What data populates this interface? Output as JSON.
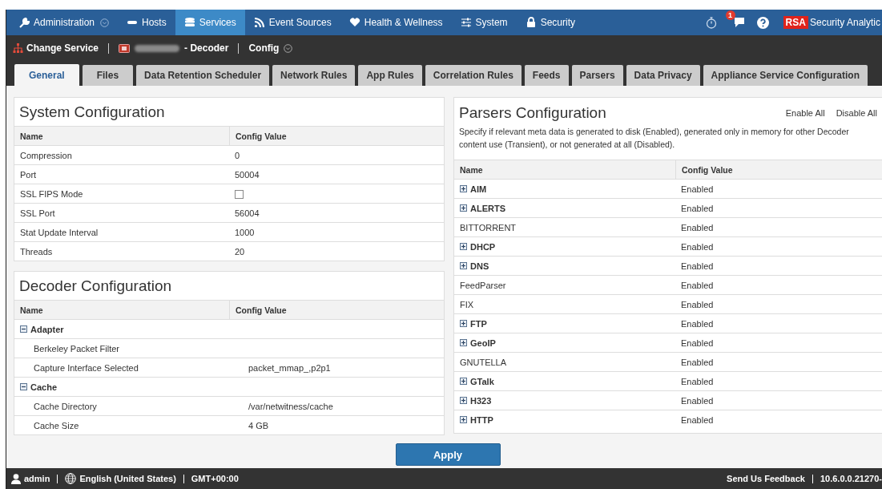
{
  "nav": {
    "items": [
      {
        "label": "Administration",
        "dropdown": true,
        "selected": false
      },
      {
        "label": "Hosts",
        "dropdown": false,
        "selected": false
      },
      {
        "label": "Services",
        "dropdown": false,
        "selected": true
      },
      {
        "label": "Event Sources",
        "dropdown": false,
        "selected": false
      },
      {
        "label": "Health & Wellness",
        "dropdown": false,
        "selected": false
      },
      {
        "label": "System",
        "dropdown": false,
        "selected": false
      },
      {
        "label": "Security",
        "dropdown": false,
        "selected": false
      }
    ],
    "notification_count": "1",
    "brand": "RSA",
    "product": "Security Analytic"
  },
  "service_bar": {
    "change_service": "Change Service",
    "service": "- Decoder",
    "view": "Config"
  },
  "tabs": [
    {
      "label": "General",
      "selected": true
    },
    {
      "label": "Files",
      "selected": false
    },
    {
      "label": "Data Retention Scheduler",
      "selected": false
    },
    {
      "label": "Network Rules",
      "selected": false
    },
    {
      "label": "App Rules",
      "selected": false
    },
    {
      "label": "Correlation Rules",
      "selected": false
    },
    {
      "label": "Feeds",
      "selected": false
    },
    {
      "label": "Parsers",
      "selected": false
    },
    {
      "label": "Data Privacy",
      "selected": false
    },
    {
      "label": "Appliance Service Configuration",
      "selected": false
    }
  ],
  "system_configuration": {
    "title": "System Configuration",
    "columns": [
      "Name",
      "Config Value"
    ],
    "rows": [
      {
        "kind": "text",
        "name": "Compression",
        "value": "0"
      },
      {
        "kind": "text",
        "name": "Port",
        "value": "50004"
      },
      {
        "kind": "checkbox",
        "name": "SSL FIPS Mode",
        "checked": false
      },
      {
        "kind": "text",
        "name": "SSL Port",
        "value": "56004"
      },
      {
        "kind": "text",
        "name": "Stat Update Interval",
        "value": "1000"
      },
      {
        "kind": "text",
        "name": "Threads",
        "value": "20"
      }
    ]
  },
  "decoder_configuration": {
    "title": "Decoder Configuration",
    "columns": [
      "Name",
      "Config Value"
    ],
    "groups": [
      {
        "name": "Adapter",
        "expanded": true,
        "children": [
          {
            "name": "Berkeley Packet Filter"
          },
          {
            "name": "Capture Interface Selected",
            "value": "packet_mmap_,p2p1"
          }
        ]
      },
      {
        "name": "Cache",
        "expanded": true,
        "children": [
          {
            "name": "Cache Directory",
            "value": "/var/netwitness/cache"
          },
          {
            "name": "Cache Size",
            "value": "4 GB"
          }
        ]
      }
    ]
  },
  "parsers_configuration": {
    "title": "Parsers Configuration",
    "actions": [
      "Enable All",
      "Disable All"
    ],
    "description": "Specify if relevant meta data is generated to disk (Enabled), generated only in memory for other Decoder content use (Transient), or not generated at all (Disabled).",
    "columns": [
      "Name",
      "Config Value"
    ],
    "rows": [
      {
        "kind": "group",
        "name": "AIM",
        "value": "Enabled",
        "expanded": false
      },
      {
        "kind": "group",
        "name": "ALERTS",
        "value": "Enabled",
        "expanded": false
      },
      {
        "kind": "leaf",
        "name": "BITTORRENT",
        "value": "Enabled"
      },
      {
        "kind": "group",
        "name": "DHCP",
        "value": "Enabled",
        "expanded": false
      },
      {
        "kind": "group",
        "name": "DNS",
        "value": "Enabled",
        "expanded": false
      },
      {
        "kind": "leaf",
        "name": "FeedParser",
        "value": "Enabled"
      },
      {
        "kind": "leaf",
        "name": "FIX",
        "value": "Enabled"
      },
      {
        "kind": "group",
        "name": "FTP",
        "value": "Enabled",
        "expanded": false
      },
      {
        "kind": "group",
        "name": "GeoIP",
        "value": "Enabled",
        "expanded": false
      },
      {
        "kind": "leaf",
        "name": "GNUTELLA",
        "value": "Enabled"
      },
      {
        "kind": "group",
        "name": "GTalk",
        "value": "Enabled",
        "expanded": false
      },
      {
        "kind": "group",
        "name": "H323",
        "value": "Enabled",
        "expanded": false
      },
      {
        "kind": "group",
        "name": "HTTP",
        "value": "Enabled",
        "expanded": false
      }
    ]
  },
  "apply_button": "Apply",
  "status_bar": {
    "user": "admin",
    "language": "English (United States)",
    "timezone": "GMT+00:00",
    "feedback": "Send Us Feedback",
    "version": "10.6.0.0.21270-"
  }
}
